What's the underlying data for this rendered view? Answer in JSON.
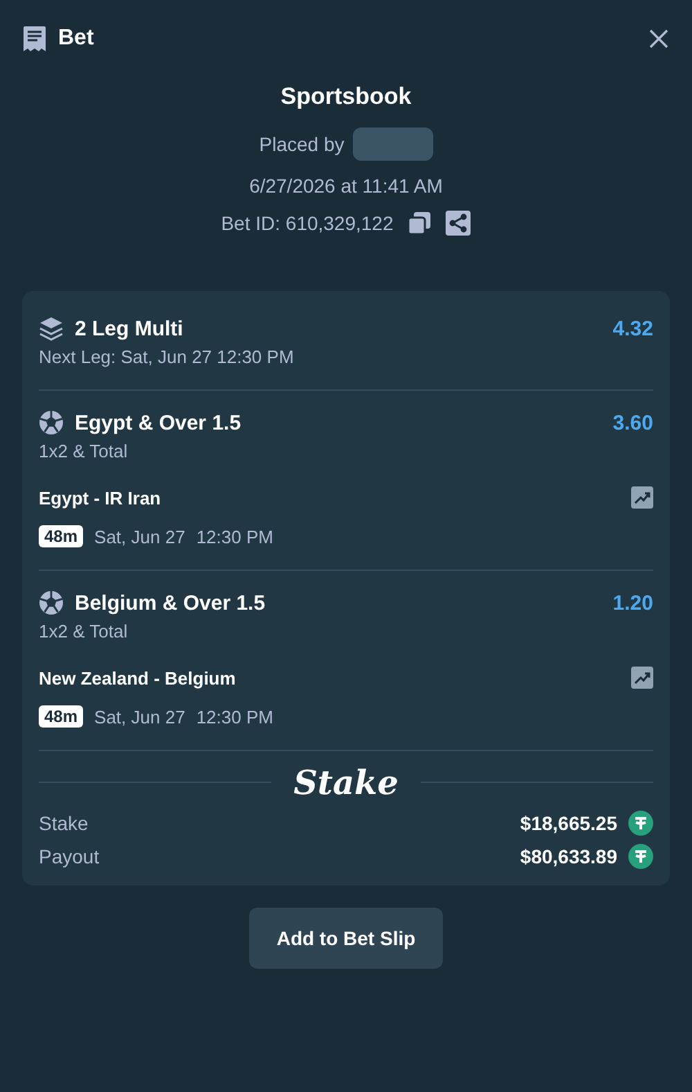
{
  "header": {
    "title": "Bet"
  },
  "summary": {
    "title": "Sportsbook",
    "placed_by": "Placed by",
    "date": "6/27/2026 at 11:41 AM",
    "bet_id": "Bet ID: 610,329,122"
  },
  "multi": {
    "title": "2 Leg Multi",
    "odds": "4.32",
    "next_leg": "Next Leg: Sat, Jun 27 12:30 PM"
  },
  "legs": [
    {
      "title": "Egypt & Over 1.5",
      "odds": "3.60",
      "market": "1x2 & Total",
      "match": "Egypt - IR Iran",
      "badge": "48m",
      "date": "Sat, Jun 27",
      "time": "12:30 PM"
    },
    {
      "title": "Belgium & Over 1.5",
      "odds": "1.20",
      "market": "1x2 & Total",
      "match": "New Zealand - Belgium",
      "badge": "48m",
      "date": "Sat, Jun 27",
      "time": "12:30 PM"
    }
  ],
  "logo": "Stake",
  "totals": [
    {
      "label": "Stake",
      "amount": "$18,665.25"
    },
    {
      "label": "Payout",
      "amount": "$80,633.89"
    }
  ],
  "button": "Add to Bet Slip"
}
